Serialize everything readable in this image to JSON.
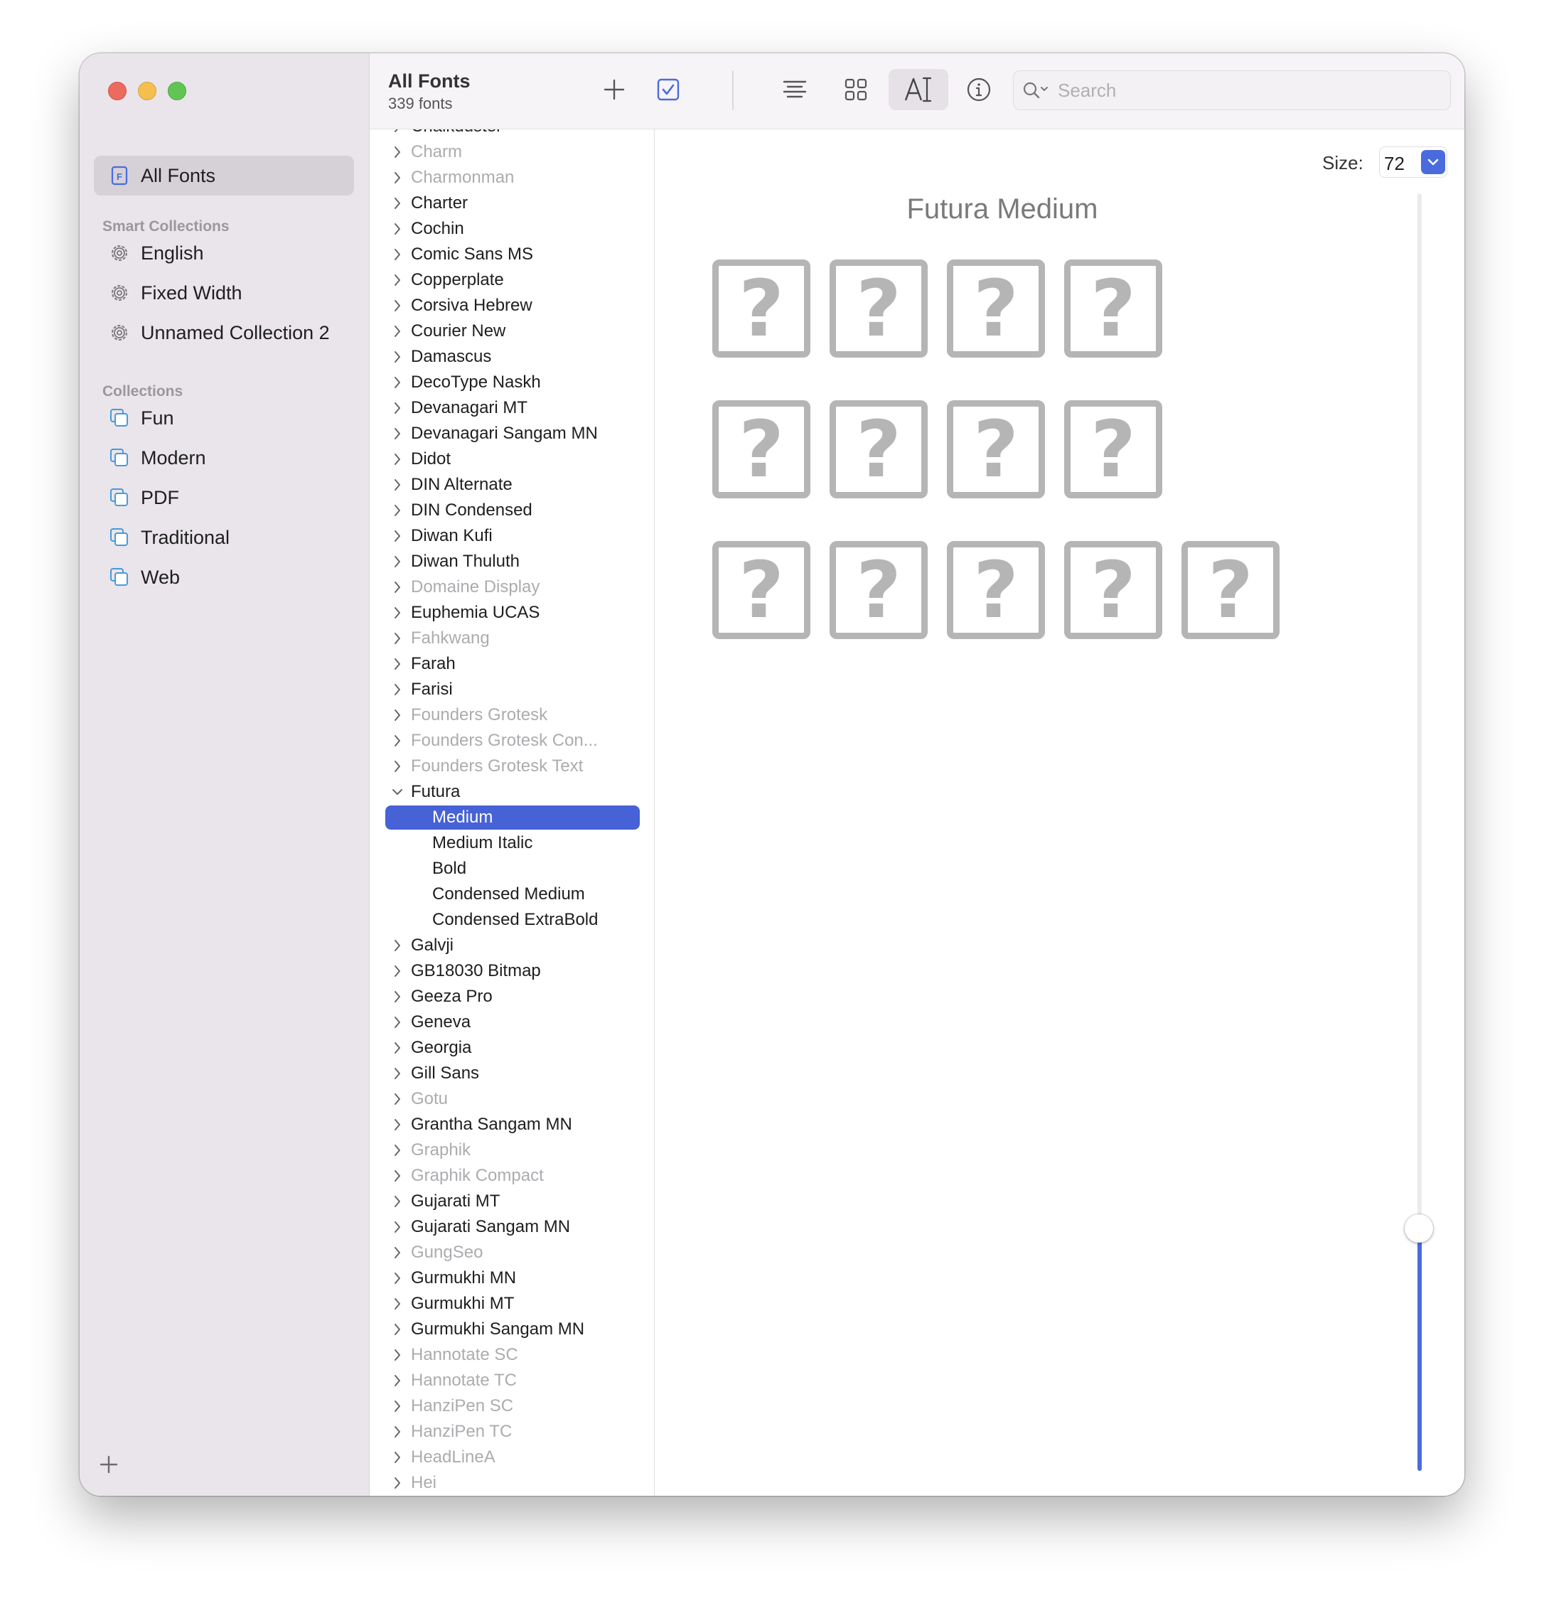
{
  "sidebar": {
    "items": [
      {
        "label": "All Fonts",
        "icon": "font-book-icon",
        "selected": true
      }
    ],
    "smart_collections_header": "Smart Collections",
    "smart_collections": [
      "English",
      "Fixed Width",
      "Unnamed Collection 2"
    ],
    "collections_header": "Collections",
    "collections": [
      "Fun",
      "Modern",
      "PDF",
      "Traditional",
      "Web"
    ]
  },
  "toolbar": {
    "title": "All Fonts",
    "subtitle": "339 fonts",
    "search_placeholder": "Search"
  },
  "font_list": {
    "items": [
      {
        "label": "Chalkduster",
        "state": "enabled",
        "level": 0,
        "expanded": false
      },
      {
        "label": "Charm",
        "state": "disabled",
        "level": 0,
        "expanded": false
      },
      {
        "label": "Charmonman",
        "state": "disabled",
        "level": 0,
        "expanded": false
      },
      {
        "label": "Charter",
        "state": "enabled",
        "level": 0,
        "expanded": false
      },
      {
        "label": "Cochin",
        "state": "enabled",
        "level": 0,
        "expanded": false
      },
      {
        "label": "Comic Sans MS",
        "state": "enabled",
        "level": 0,
        "expanded": false
      },
      {
        "label": "Copperplate",
        "state": "enabled",
        "level": 0,
        "expanded": false
      },
      {
        "label": "Corsiva Hebrew",
        "state": "enabled",
        "level": 0,
        "expanded": false
      },
      {
        "label": "Courier New",
        "state": "enabled",
        "level": 0,
        "expanded": false
      },
      {
        "label": "Damascus",
        "state": "enabled",
        "level": 0,
        "expanded": false
      },
      {
        "label": "DecoType Naskh",
        "state": "enabled",
        "level": 0,
        "expanded": false
      },
      {
        "label": "Devanagari MT",
        "state": "enabled",
        "level": 0,
        "expanded": false
      },
      {
        "label": "Devanagari Sangam MN",
        "state": "enabled",
        "level": 0,
        "expanded": false
      },
      {
        "label": "Didot",
        "state": "enabled",
        "level": 0,
        "expanded": false
      },
      {
        "label": "DIN Alternate",
        "state": "enabled",
        "level": 0,
        "expanded": false
      },
      {
        "label": "DIN Condensed",
        "state": "enabled",
        "level": 0,
        "expanded": false
      },
      {
        "label": "Diwan Kufi",
        "state": "enabled",
        "level": 0,
        "expanded": false
      },
      {
        "label": "Diwan Thuluth",
        "state": "enabled",
        "level": 0,
        "expanded": false
      },
      {
        "label": "Domaine Display",
        "state": "disabled",
        "level": 0,
        "expanded": false
      },
      {
        "label": "Euphemia UCAS",
        "state": "enabled",
        "level": 0,
        "expanded": false
      },
      {
        "label": "Fahkwang",
        "state": "disabled",
        "level": 0,
        "expanded": false
      },
      {
        "label": "Farah",
        "state": "enabled",
        "level": 0,
        "expanded": false
      },
      {
        "label": "Farisi",
        "state": "enabled",
        "level": 0,
        "expanded": false
      },
      {
        "label": "Founders Grotesk",
        "state": "disabled",
        "level": 0,
        "expanded": false
      },
      {
        "label": "Founders Grotesk Con...",
        "state": "disabled",
        "level": 0,
        "expanded": false
      },
      {
        "label": "Founders Grotesk Text",
        "state": "disabled",
        "level": 0,
        "expanded": false
      },
      {
        "label": "Futura",
        "state": "enabled",
        "level": 0,
        "expanded": true
      },
      {
        "label": "Medium",
        "state": "selected",
        "level": 1
      },
      {
        "label": "Medium Italic",
        "state": "enabled",
        "level": 1
      },
      {
        "label": "Bold",
        "state": "enabled",
        "level": 1
      },
      {
        "label": "Condensed Medium",
        "state": "enabled",
        "level": 1
      },
      {
        "label": "Condensed ExtraBold",
        "state": "enabled",
        "level": 1
      },
      {
        "label": "Galvji",
        "state": "enabled",
        "level": 0,
        "expanded": false
      },
      {
        "label": "GB18030 Bitmap",
        "state": "enabled",
        "level": 0,
        "expanded": false
      },
      {
        "label": "Geeza Pro",
        "state": "enabled",
        "level": 0,
        "expanded": false
      },
      {
        "label": "Geneva",
        "state": "enabled",
        "level": 0,
        "expanded": false
      },
      {
        "label": "Georgia",
        "state": "enabled",
        "level": 0,
        "expanded": false
      },
      {
        "label": "Gill Sans",
        "state": "enabled",
        "level": 0,
        "expanded": false
      },
      {
        "label": "Gotu",
        "state": "disabled",
        "level": 0,
        "expanded": false
      },
      {
        "label": "Grantha Sangam MN",
        "state": "enabled",
        "level": 0,
        "expanded": false
      },
      {
        "label": "Graphik",
        "state": "disabled",
        "level": 0,
        "expanded": false
      },
      {
        "label": "Graphik Compact",
        "state": "disabled",
        "level": 0,
        "expanded": false
      },
      {
        "label": "Gujarati MT",
        "state": "enabled",
        "level": 0,
        "expanded": false
      },
      {
        "label": "Gujarati Sangam MN",
        "state": "enabled",
        "level": 0,
        "expanded": false
      },
      {
        "label": "GungSeo",
        "state": "disabled",
        "level": 0,
        "expanded": false
      },
      {
        "label": "Gurmukhi MN",
        "state": "enabled",
        "level": 0,
        "expanded": false
      },
      {
        "label": "Gurmukhi MT",
        "state": "enabled",
        "level": 0,
        "expanded": false
      },
      {
        "label": "Gurmukhi Sangam MN",
        "state": "enabled",
        "level": 0,
        "expanded": false
      },
      {
        "label": "Hannotate SC",
        "state": "disabled",
        "level": 0,
        "expanded": false
      },
      {
        "label": "Hannotate TC",
        "state": "disabled",
        "level": 0,
        "expanded": false
      },
      {
        "label": "HanziPen SC",
        "state": "disabled",
        "level": 0,
        "expanded": false
      },
      {
        "label": "HanziPen TC",
        "state": "disabled",
        "level": 0,
        "expanded": false
      },
      {
        "label": "HeadLineA",
        "state": "disabled",
        "level": 0,
        "expanded": false
      },
      {
        "label": "Hei",
        "state": "disabled",
        "level": 0,
        "expanded": false
      }
    ]
  },
  "preview": {
    "size_label": "Size:",
    "size_value": "72",
    "font_name": "Futura Medium",
    "glyph_rows": [
      4,
      4,
      5
    ],
    "glyph_char": "?",
    "size_slider_level": 0.19
  },
  "colors": {
    "accent": "#4762d6",
    "sidebar_bg": "#e9e5ea",
    "disabled_text": "#adabaf",
    "placeholder_glyph": "#b5b5b5"
  }
}
